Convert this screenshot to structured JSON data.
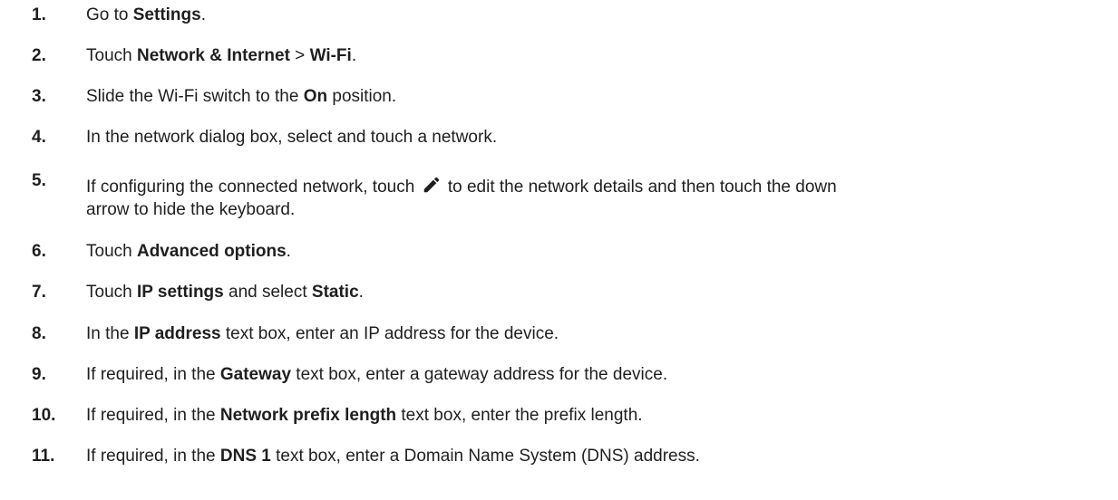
{
  "steps": [
    {
      "num": "1.",
      "parts": [
        "Go to ",
        "Settings",
        "."
      ]
    },
    {
      "num": "2.",
      "parts": [
        "Touch ",
        "Network & Internet",
        " > ",
        "Wi-Fi",
        "."
      ]
    },
    {
      "num": "3.",
      "parts": [
        "Slide the Wi-Fi switch to the ",
        "On",
        " position."
      ]
    },
    {
      "num": "4.",
      "text": "In the network dialog box, select and touch a network."
    },
    {
      "num": "5.",
      "parts": [
        "If configuring the connected network, touch ",
        "to edit the network details and then touch the down",
        "arrow to hide the keyboard."
      ],
      "icon": "edit-pencil-icon"
    },
    {
      "num": "6.",
      "parts": [
        "Touch ",
        "Advanced options",
        "."
      ]
    },
    {
      "num": "7.",
      "parts": [
        "Touch ",
        "IP settings",
        " and select ",
        "Static",
        "."
      ]
    },
    {
      "num": "8.",
      "parts": [
        "In the ",
        "IP address",
        " text box, enter an IP address for the device."
      ]
    },
    {
      "num": "9.",
      "parts": [
        "If required, in the ",
        "Gateway",
        " text box, enter a gateway address for the device."
      ]
    },
    {
      "num": "10.",
      "parts": [
        "If required, in the ",
        "Network prefix length",
        " text box, enter the prefix length."
      ]
    },
    {
      "num": "11.",
      "parts": [
        "If required, in the ",
        "DNS 1",
        " text box, enter a Domain Name System (DNS) address."
      ]
    }
  ]
}
